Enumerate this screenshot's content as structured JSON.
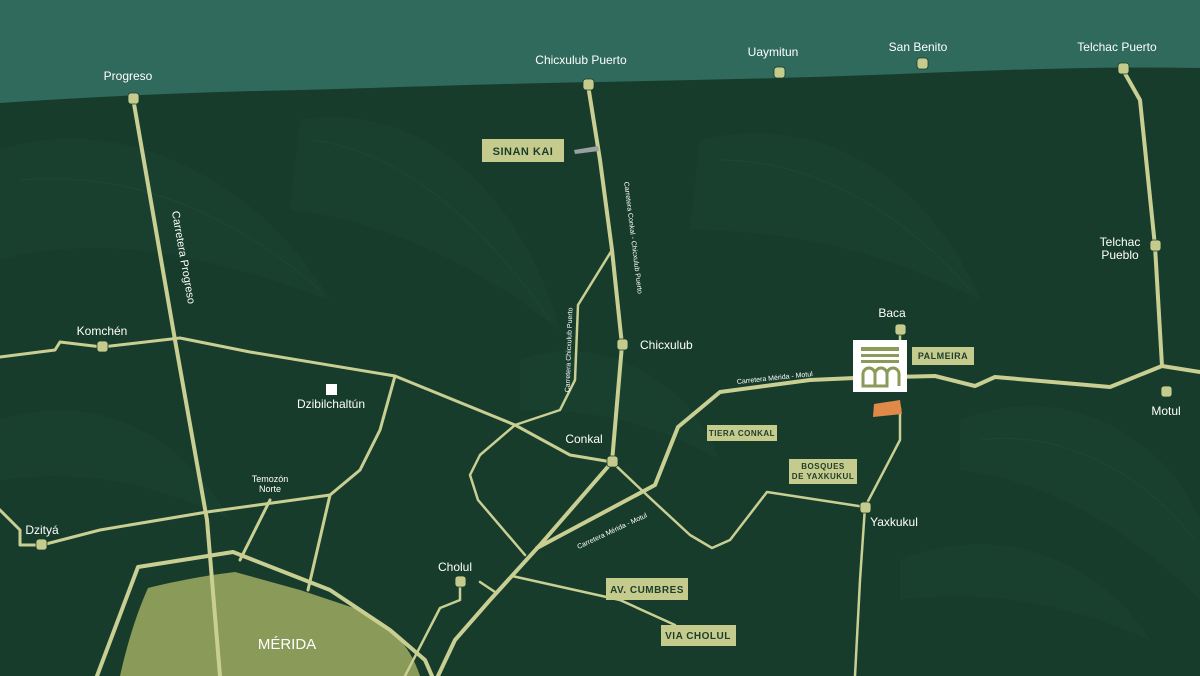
{
  "colors": {
    "sea": "#2f6a5c",
    "land": "#173c2c",
    "road": "#c9cf92",
    "city_area": "#8a9a58",
    "tag_bg": "#c5cb8d",
    "tag_text": "#1d3d2c",
    "accent": "#e08a4a"
  },
  "places": {
    "progreso": "Progreso",
    "chicxulub_puerto": "Chicxulub Puerto",
    "uaymitun": "Uaymitun",
    "san_benito": "San Benito",
    "telchac_puerto": "Telchac Puerto",
    "telchac_pueblo_1": "Telchac",
    "telchac_pueblo_2": "Pueblo",
    "komchen": "Komchén",
    "dzibilchaltun": "Dzibilchaltún",
    "chicxulub": "Chicxulub",
    "baca": "Baca",
    "motul": "Motul",
    "conkal": "Conkal",
    "temozon_1": "Temozón",
    "temozon_2": "Norte",
    "dzitya": "Dzityá",
    "yaxkukul": "Yaxkukul",
    "cholul": "Cholul",
    "merida": "MÉRIDA"
  },
  "roads": {
    "progreso": "Carretera Progreso",
    "conkal_chicxulub": "Carretera Conkal - Chicxulub Puerto",
    "chicxulub_puerto": "Carretera  Chicxulub Puerto",
    "merida_motul_north": "Carretera Mérida - Motul",
    "merida_motul_south": "Carretera Mérida - Motul"
  },
  "developments": {
    "sinan_kai": "SINAN KAI",
    "palmeira": "PALMEIRA",
    "tiera_conkal": "TIERA CONKAL",
    "bosques_1": "BOSQUES",
    "bosques_2": "DE YAXKUKUL",
    "av_cumbres": "AV. CUMBRES",
    "via_cholul": "VIA CHOLUL"
  },
  "icons": {
    "project_logo": "arch-building-logo-icon",
    "town_marker": "town-dot-icon",
    "landmark_marker": "white-square-icon"
  }
}
